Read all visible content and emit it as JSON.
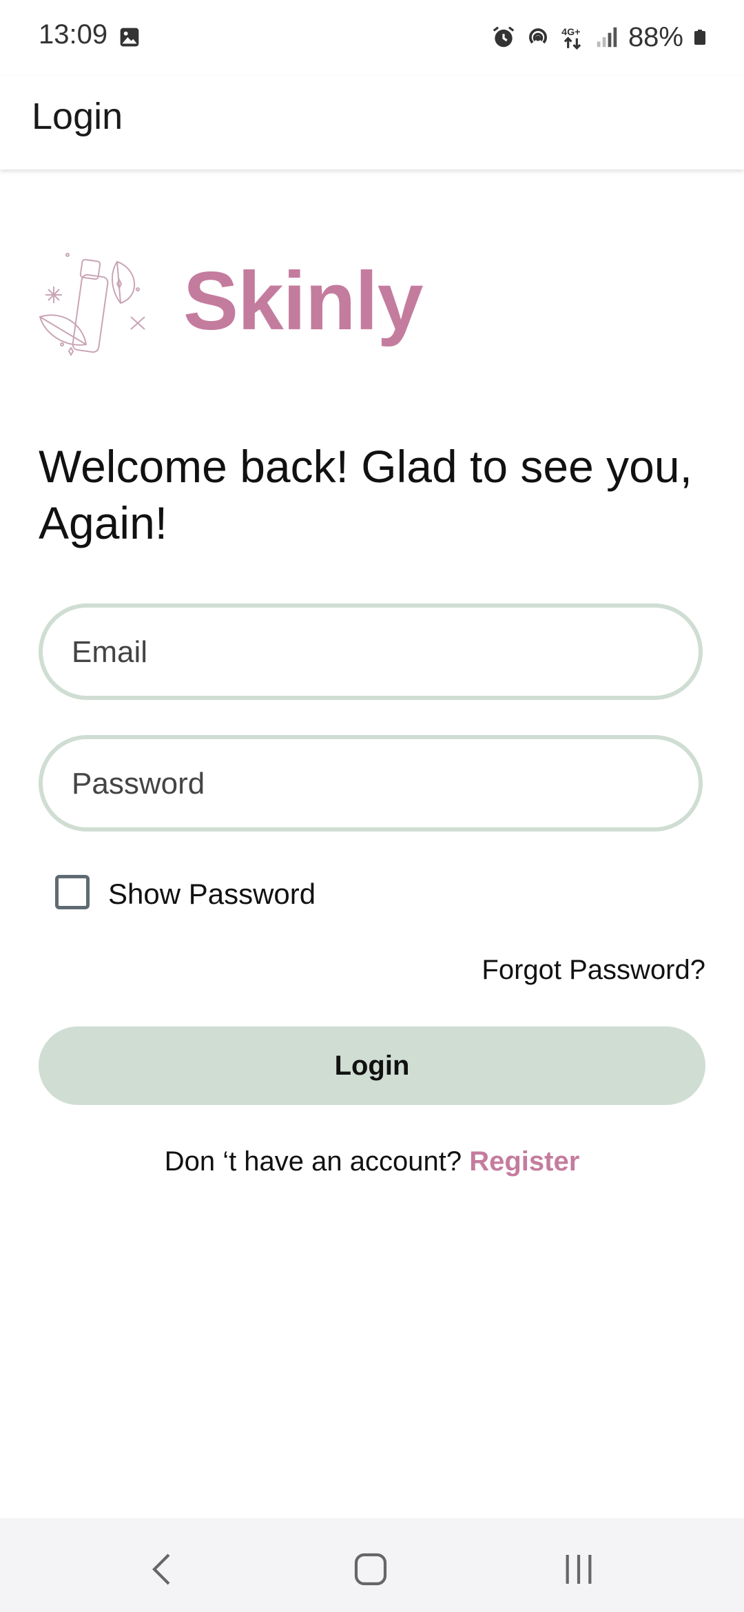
{
  "status_bar": {
    "time": "13:09",
    "battery": "88%",
    "icons": [
      "gallery-icon",
      "alarm-icon",
      "hotspot-icon",
      "network-4g-icon",
      "signal-icon",
      "battery-icon"
    ]
  },
  "app_bar": {
    "title": "Login"
  },
  "logo": {
    "brand": "Skinly",
    "art_icon": "skincare-illustration-icon",
    "brand_color": "#c47c9e"
  },
  "welcome_text": "Welcome back! Glad to see you, Again!",
  "form": {
    "email": {
      "placeholder": "Email",
      "value": ""
    },
    "password": {
      "placeholder": "Password",
      "value": ""
    },
    "show_password": {
      "label": "Show Password",
      "checked": false
    },
    "forgot_password": "Forgot Password?",
    "login_button": "Login",
    "register_prompt": "Don ‘t have an account?",
    "register_link": "Register"
  },
  "colors": {
    "accent_green": "#cfddd3",
    "accent_pink": "#c47c9e"
  },
  "nav_bar": {
    "icons": [
      "back-icon",
      "home-icon",
      "recent-apps-icon"
    ]
  }
}
